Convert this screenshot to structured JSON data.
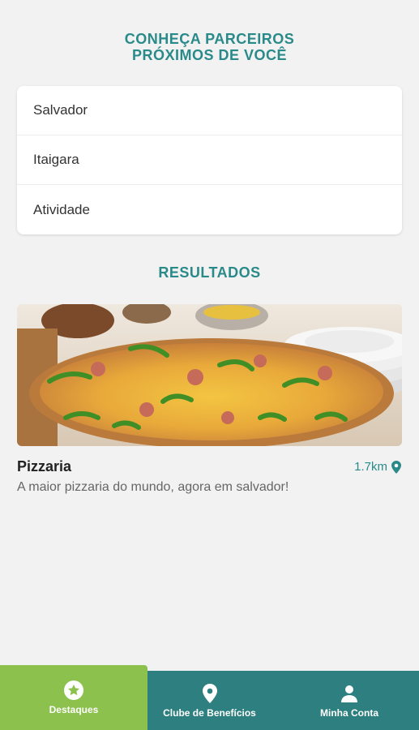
{
  "header": {
    "title_line1": "CONHEÇA PARCEIROS",
    "title_line2": "PRÓXIMOS DE VOCÊ"
  },
  "filters": [
    {
      "label": "Salvador"
    },
    {
      "label": "Itaigara"
    },
    {
      "label": "Atividade"
    }
  ],
  "results": {
    "title": "RESULTADOS",
    "items": [
      {
        "name": "Pizzaria",
        "distance": "1.7km",
        "description": "A maior pizzaria do mundo, agora em salvador!"
      }
    ]
  },
  "nav": {
    "items": [
      {
        "label": "Destaques",
        "icon": "star-icon",
        "active": true
      },
      {
        "label": "Clube de Benefícios",
        "icon": "location-pin-icon",
        "active": false
      },
      {
        "label": "Minha Conta",
        "icon": "person-icon",
        "active": false
      }
    ]
  },
  "colors": {
    "teal": "#2a8a8a",
    "nav_bg": "#2e7f7f",
    "active_green": "#8dc14e"
  }
}
